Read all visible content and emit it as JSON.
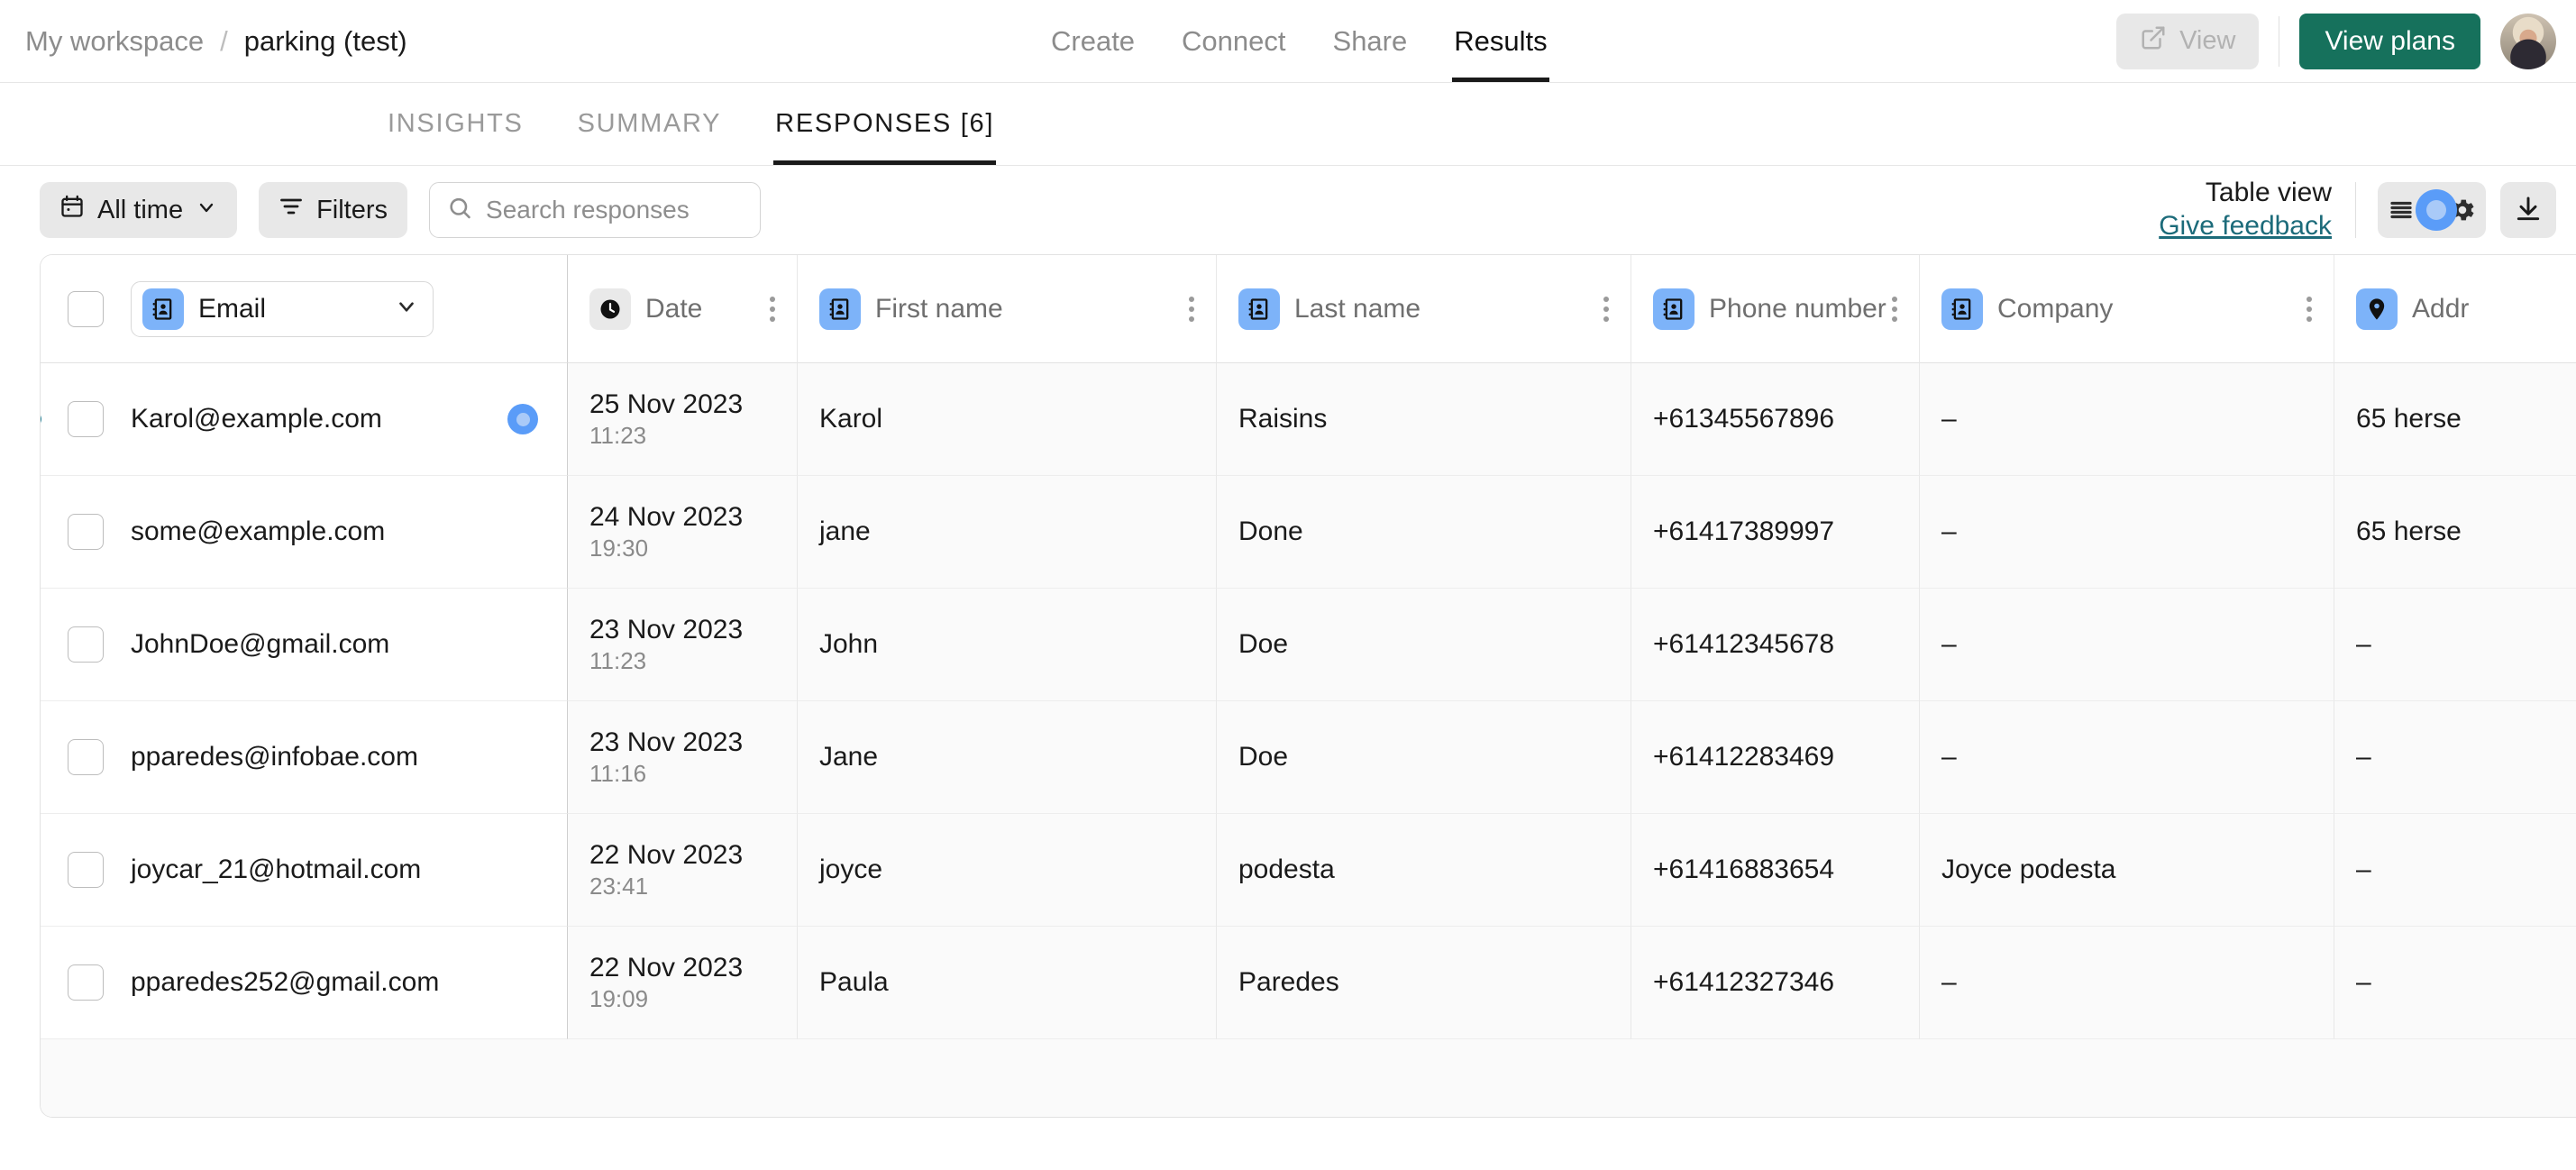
{
  "header": {
    "breadcrumb": {
      "workspace": "My workspace",
      "separator": "/",
      "current": "parking (test)"
    },
    "nav_tabs": [
      {
        "label": "Create",
        "active": false
      },
      {
        "label": "Connect",
        "active": false
      },
      {
        "label": "Share",
        "active": false
      },
      {
        "label": "Results",
        "active": true
      }
    ],
    "view_button": {
      "label": "View",
      "icon": "external-link-icon",
      "disabled": true
    },
    "plans_button": {
      "label": "View plans",
      "color": "#16715c"
    },
    "avatar": "user-avatar"
  },
  "subtabs": [
    {
      "label": "INSIGHTS",
      "active": false
    },
    {
      "label": "SUMMARY",
      "active": false
    },
    {
      "label": "RESPONSES [6]",
      "active": true
    }
  ],
  "toolbar": {
    "date_filter": {
      "label": "All time",
      "icon": "calendar-icon",
      "chevron": "chevron-down-icon"
    },
    "filters": {
      "label": "Filters",
      "icon": "funnel-icon"
    },
    "search": {
      "placeholder": "Search responses",
      "value": "",
      "icon": "search-icon"
    },
    "table_view": {
      "title": "Table view",
      "feedback_link": "Give feedback"
    },
    "view_toggle": {
      "list_icon": "list-view-icon",
      "knob": "toggle-knob",
      "gear_icon": "gear-icon"
    },
    "download": {
      "icon": "download-icon"
    }
  },
  "table": {
    "email_column": {
      "label": "Email",
      "icon": "contact-card-icon",
      "chevron": "chevron-down-icon"
    },
    "columns": [
      {
        "label": "Date",
        "icon": "clock-icon",
        "icon_style": "gray"
      },
      {
        "label": "First name",
        "icon": "contact-card-icon",
        "icon_style": "blue"
      },
      {
        "label": "Last name",
        "icon": "contact-card-icon",
        "icon_style": "blue"
      },
      {
        "label": "Phone number",
        "icon": "contact-card-icon",
        "icon_style": "blue"
      },
      {
        "label": "Company",
        "icon": "contact-card-icon",
        "icon_style": "blue"
      },
      {
        "label": "Addr",
        "icon": "map-pin-icon",
        "icon_style": "blue"
      }
    ],
    "rows": [
      {
        "email": "Karol@example.com",
        "date": "25 Nov 2023",
        "time": "11:23",
        "first_name": "Karol",
        "last_name": "Raisins",
        "phone": "+61345567896",
        "company": "–",
        "address": "65 herse",
        "unread": true,
        "badge": true
      },
      {
        "email": "some@example.com",
        "date": "24 Nov 2023",
        "time": "19:30",
        "first_name": "jane",
        "last_name": "Done",
        "phone": "+61417389997",
        "company": "–",
        "address": "65 herse",
        "unread": false,
        "badge": false
      },
      {
        "email": "JohnDoe@gmail.com",
        "date": "23 Nov 2023",
        "time": "11:23",
        "first_name": "John",
        "last_name": "Doe",
        "phone": "+61412345678",
        "company": "–",
        "address": "–",
        "unread": false,
        "badge": false
      },
      {
        "email": "pparedes@infobae.com",
        "date": "23 Nov 2023",
        "time": "11:16",
        "first_name": "Jane",
        "last_name": "Doe",
        "phone": "+61412283469",
        "company": "–",
        "address": "–",
        "unread": false,
        "badge": false
      },
      {
        "email": "joycar_21@hotmail.com",
        "date": "22 Nov 2023",
        "time": "23:41",
        "first_name": "joyce",
        "last_name": "podesta",
        "phone": "+61416883654",
        "company": "Joyce podesta",
        "address": "–",
        "unread": false,
        "badge": false
      },
      {
        "email": "pparedes252@gmail.com",
        "date": "22 Nov 2023",
        "time": "19:09",
        "first_name": "Paula",
        "last_name": "Paredes",
        "phone": "+61412327346",
        "company": "–",
        "address": "–",
        "unread": false,
        "badge": false
      }
    ]
  }
}
